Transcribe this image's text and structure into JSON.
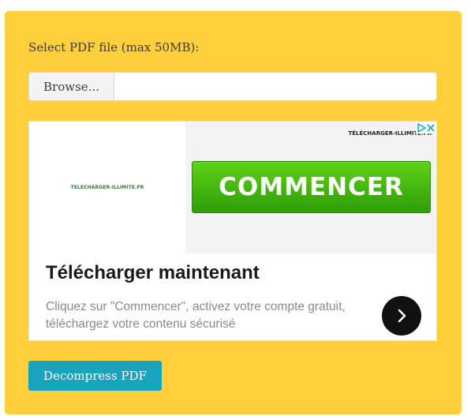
{
  "form": {
    "file_label": "Select PDF file (max 50MB):",
    "browse_label": "Browse...",
    "submit_label": "Decompress PDF"
  },
  "ad": {
    "logo_text": "TELECHARGER-ILLIMITE.FR",
    "brand_text": "TÉLÉCHARGER-ILLIMITÉ.FR",
    "cta_label": "COMMENCER",
    "title": "Télécharger maintenant",
    "description": "Cliquez sur \"Commencer\", activez votre compte gratuit, téléchargez votre contenu sécurisé",
    "colors": {
      "cta_green": "#4cbf12",
      "arrow_bg": "#111111",
      "adchoices_blue": "#00aecd"
    },
    "icons": [
      "adchoices-icon",
      "close-icon",
      "chevron-right-icon"
    ]
  },
  "colors": {
    "panel": "#ffd03b",
    "button": "#1aa3bd"
  }
}
